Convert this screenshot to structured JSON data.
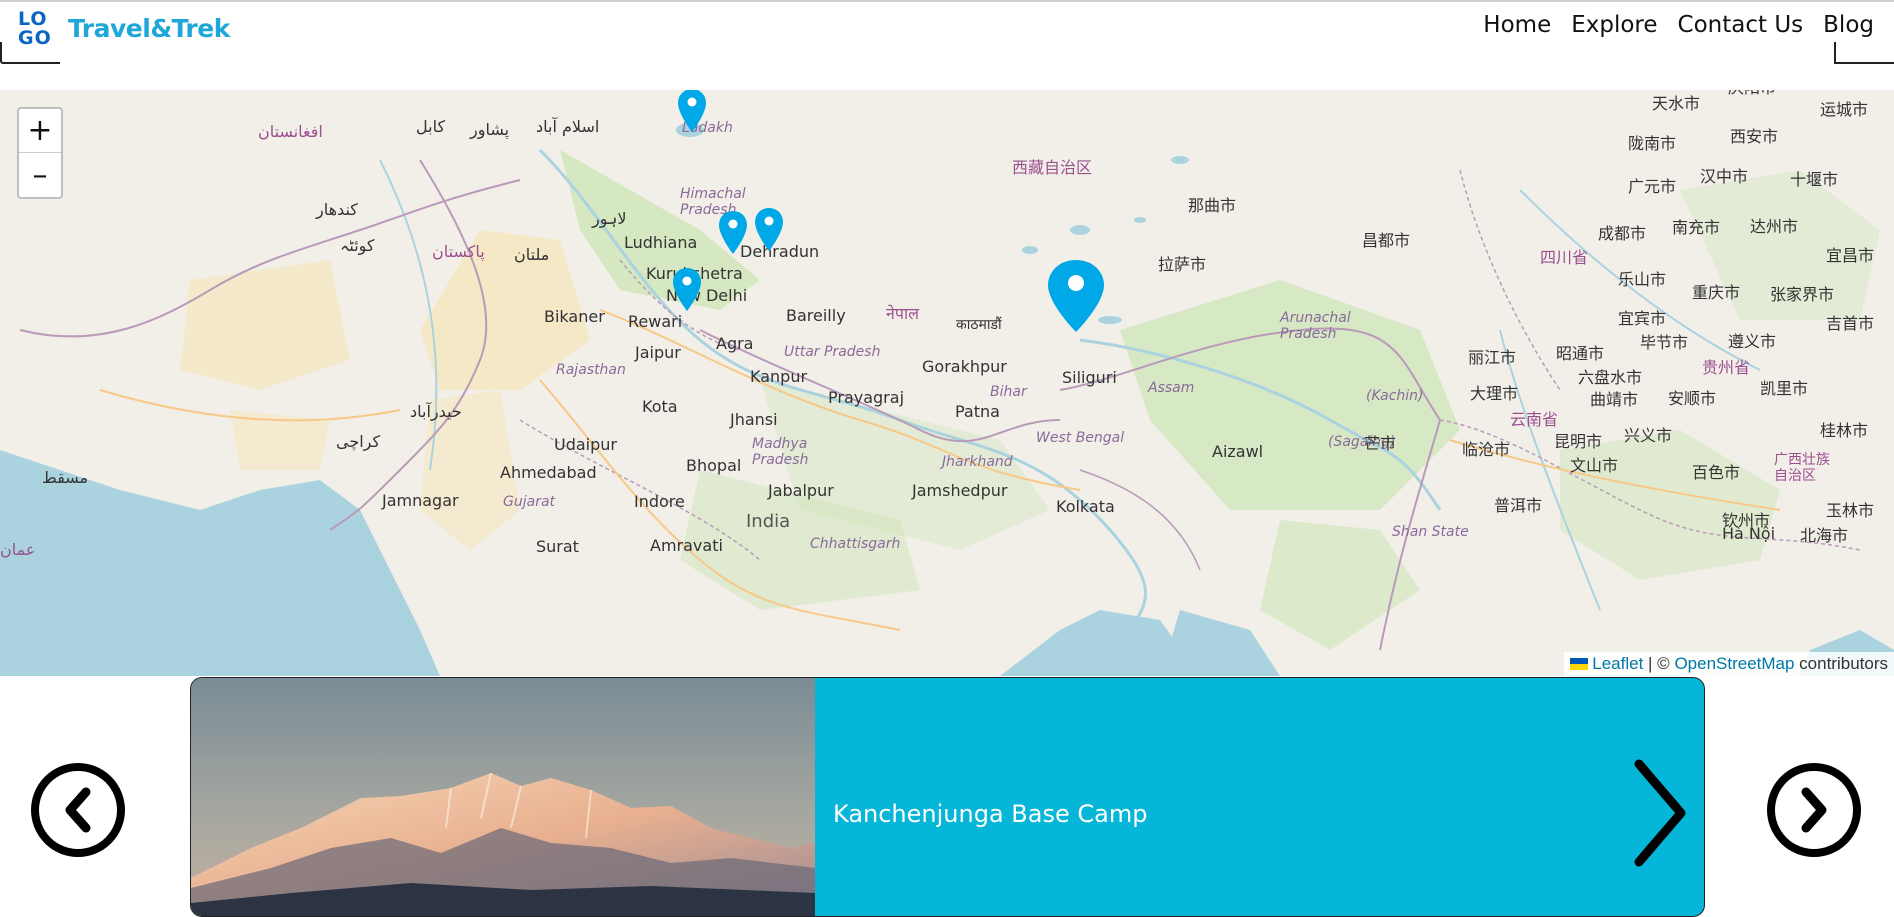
{
  "header": {
    "logo_lines": [
      "LO",
      "GO"
    ],
    "brand": "Travel&Trek",
    "nav": [
      "Home",
      "Explore",
      "Contact Us",
      "Blog"
    ]
  },
  "map": {
    "zoom_in": "+",
    "zoom_out": "–",
    "labels": {
      "ladakh": "Ladakh",
      "himachal": "Himachal Pradesh",
      "ludhiana": "Ludhiana",
      "dehradun": "Dehradun",
      "kurukshetra": "Kurukshetra",
      "new_delhi": "New Delhi",
      "bikaner": "Bikaner",
      "rewari": "Rewari",
      "bareilly": "Bareilly",
      "jaipur": "Jaipur",
      "agra": "Agra",
      "uttar_pradesh": "Uttar Pradesh",
      "rajasthan": "Rajasthan",
      "kanpur": "Kanpur",
      "prayagraj": "Prayagraj",
      "gorakhpur": "Gorakhpur",
      "kota": "Kota",
      "jhansi": "Jhansi",
      "patna": "Patna",
      "bihar": "Bihar",
      "udaipur": "Udaipur",
      "madhya_pradesh": "Madhya Pradesh",
      "ahmedabad": "Ahmedabad",
      "bhopal": "Bhopal",
      "jharkhand": "Jharkhand",
      "jamnagar": "Jamnagar",
      "gujarat": "Gujarat",
      "indore": "Indore",
      "jabalpur": "Jabalpur",
      "jamshedpur": "Jamshedpur",
      "india": "India",
      "surat": "Surat",
      "amravati": "Amravati",
      "chhattisgarh": "Chhattisgarh",
      "kolkata": "Kolkata",
      "siliguri": "Siliguri",
      "west_bengal": "West Bengal",
      "assam": "Assam",
      "aizawl": "Aizawl",
      "arunachal": "Arunachal Pradesh",
      "kachin": "(Kachin)",
      "sagaing": "(Sagaing)",
      "shan": "Shan State",
      "nepal": "नेपाल",
      "kathmandu": "काठमाडौं",
      "lhasa": "拉萨市",
      "nagqu": "那曲市",
      "changdu": "昌都市",
      "xizang": "西藏自治区",
      "chengdu": "成都市",
      "nanchong": "南充市",
      "dazhou": "达州市",
      "guangyuan": "广元市",
      "hanzhong": "汉中市",
      "shiyan": "十堰市",
      "tianshui": "天水市",
      "longnan": "陇南市",
      "xian": "西安市",
      "qingyang": "庆阳市",
      "yuncheng": "运城市",
      "sichuan": "四川省",
      "leshan": "乐山市",
      "chongqing": "重庆市",
      "zhangjiajie": "张家界市",
      "yibin": "宜宾市",
      "bijie": "毕节市",
      "zunyi": "遵义市",
      "yichang": "宜昌市",
      "jishou": "吉首市",
      "lijiang": "丽江市",
      "zhaotong": "昭通市",
      "liupanshui": "六盘水市",
      "guizhou": "贵州省",
      "dali": "大理市",
      "qujing": "曲靖市",
      "anshun": "安顺市",
      "kaili": "凯里市",
      "yunnan": "云南省",
      "baoshan": "临沧市",
      "kunming": "昆明市",
      "xingyi": "兴义市",
      "guilin": "桂林市",
      "wenshan": "文山市",
      "baise": "百色市",
      "guangxi": "广西壮族自治区",
      "pu_er": "普洱市",
      "yulin": "玉林市",
      "qinzhou": "钦州市",
      "beihai": "北海市",
      "hanoi": "Hà Nội",
      "mangshi": "芒市",
      "kabul": "کابل",
      "islamabad": "اسلام آباد",
      "peshawar": "پشاور",
      "lahore": "لاہور",
      "pakistan": "پاکستان",
      "afghanistan": "افغانستان",
      "multan": "ملتان",
      "karachi": "کراچی",
      "hyderabad": "حیدرآباد",
      "kandahar": "کندهار",
      "quetta": "کوئٹہ",
      "oman": "عمان",
      "muscat": "مسقط"
    },
    "attribution": {
      "leaflet": "Leaflet",
      "sep": " | © ",
      "osm": "OpenStreetMap",
      "suffix": " contributors"
    },
    "colors": {
      "water": "#aad3df",
      "land": "#f2efe9",
      "green": "#cde6b8",
      "desert": "#f5e6b8",
      "marker": "#00a8e8",
      "border": "#b99ab9"
    }
  },
  "carousel": {
    "card_title": "Kanchenjunga Base Camp",
    "accent": "#06b6d8"
  }
}
